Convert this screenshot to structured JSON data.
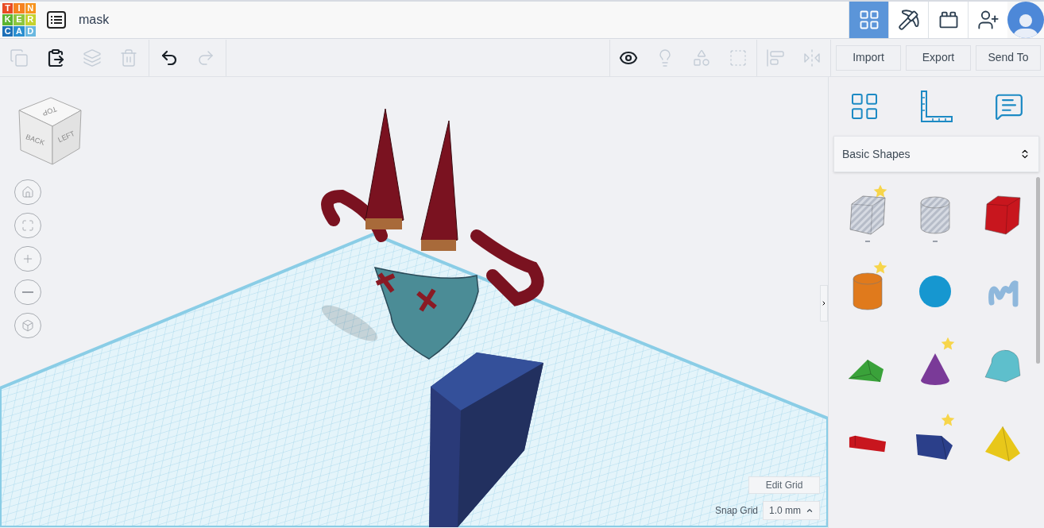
{
  "logo": {
    "letters": [
      {
        "char": "T",
        "color": "#e84b24"
      },
      {
        "char": "I",
        "color": "#f58220"
      },
      {
        "char": "N",
        "color": "#f7941e"
      },
      {
        "char": "K",
        "color": "#5cb431"
      },
      {
        "char": "E",
        "color": "#8dc63f"
      },
      {
        "char": "R",
        "color": "#c6d22e"
      },
      {
        "char": "C",
        "color": "#1c6fb7"
      },
      {
        "char": "A",
        "color": "#2a8fd0"
      },
      {
        "char": "D",
        "color": "#6ab8e0"
      }
    ]
  },
  "design_title": "mask",
  "nav": [
    {
      "kind": "grid",
      "selected": true
    },
    {
      "kind": "pickaxe",
      "selected": false
    },
    {
      "kind": "brick",
      "selected": false
    },
    {
      "kind": "add-user",
      "selected": false
    },
    {
      "kind": "avatar",
      "selected": false
    }
  ],
  "toolbar_left": [
    {
      "kind": "copy",
      "disabled": true
    },
    {
      "kind": "paste",
      "disabled": false
    },
    {
      "kind": "duplicate",
      "disabled": true
    },
    {
      "kind": "delete",
      "disabled": true
    },
    {
      "kind": "undo",
      "disabled": false
    },
    {
      "kind": "redo",
      "disabled": true
    }
  ],
  "toolbar_right": [
    {
      "kind": "notes",
      "disabled": false
    },
    {
      "kind": "light",
      "disabled": true
    },
    {
      "kind": "group",
      "disabled": true
    },
    {
      "kind": "hole",
      "disabled": true
    },
    {
      "kind": "align",
      "disabled": true
    },
    {
      "kind": "mirror",
      "disabled": true
    }
  ],
  "actions": [
    "Import",
    "Export",
    "Send To"
  ],
  "view_cube": {
    "top": "TOP",
    "front": "BACK",
    "side": "LEFT"
  },
  "view_controls": [
    {
      "kind": "home"
    },
    {
      "kind": "fit"
    },
    {
      "kind": "zoom-in"
    },
    {
      "kind": "zoom-out"
    },
    {
      "kind": "perspective"
    }
  ],
  "grid_controls": {
    "edit_button": "Edit Grid",
    "snap_label": "Snap Grid",
    "snap_value": "1.0 mm"
  },
  "panel": {
    "category": "Basic Shapes",
    "shapes": [
      {
        "kind": "box",
        "color": "#c8ccd6",
        "hole": true,
        "favorite": true
      },
      {
        "kind": "cylinder",
        "color": "#c8ccd6",
        "hole": true,
        "favorite": false
      },
      {
        "kind": "box",
        "color": "#c8161e",
        "hole": false,
        "favorite": false
      },
      {
        "kind": "cylinder",
        "color": "#e07a1c",
        "hole": false,
        "favorite": true
      },
      {
        "kind": "sphere",
        "color": "#1697d0",
        "hole": false,
        "favorite": false
      },
      {
        "kind": "scribble",
        "color": "#8fb8dc",
        "hole": false,
        "favorite": false
      },
      {
        "kind": "roof",
        "color": "#3aa23a",
        "hole": false,
        "favorite": false
      },
      {
        "kind": "cone",
        "color": "#7a3a98",
        "hole": false,
        "favorite": true
      },
      {
        "kind": "round-roof",
        "color": "#5ebfcc",
        "hole": false,
        "favorite": false
      },
      {
        "kind": "text",
        "color": "#c8161e",
        "hole": false,
        "favorite": false
      },
      {
        "kind": "polygon",
        "color": "#2b3f8a",
        "hole": false,
        "favorite": true
      },
      {
        "kind": "pyramid",
        "color": "#e8c71a",
        "hole": false,
        "favorite": false
      }
    ]
  }
}
